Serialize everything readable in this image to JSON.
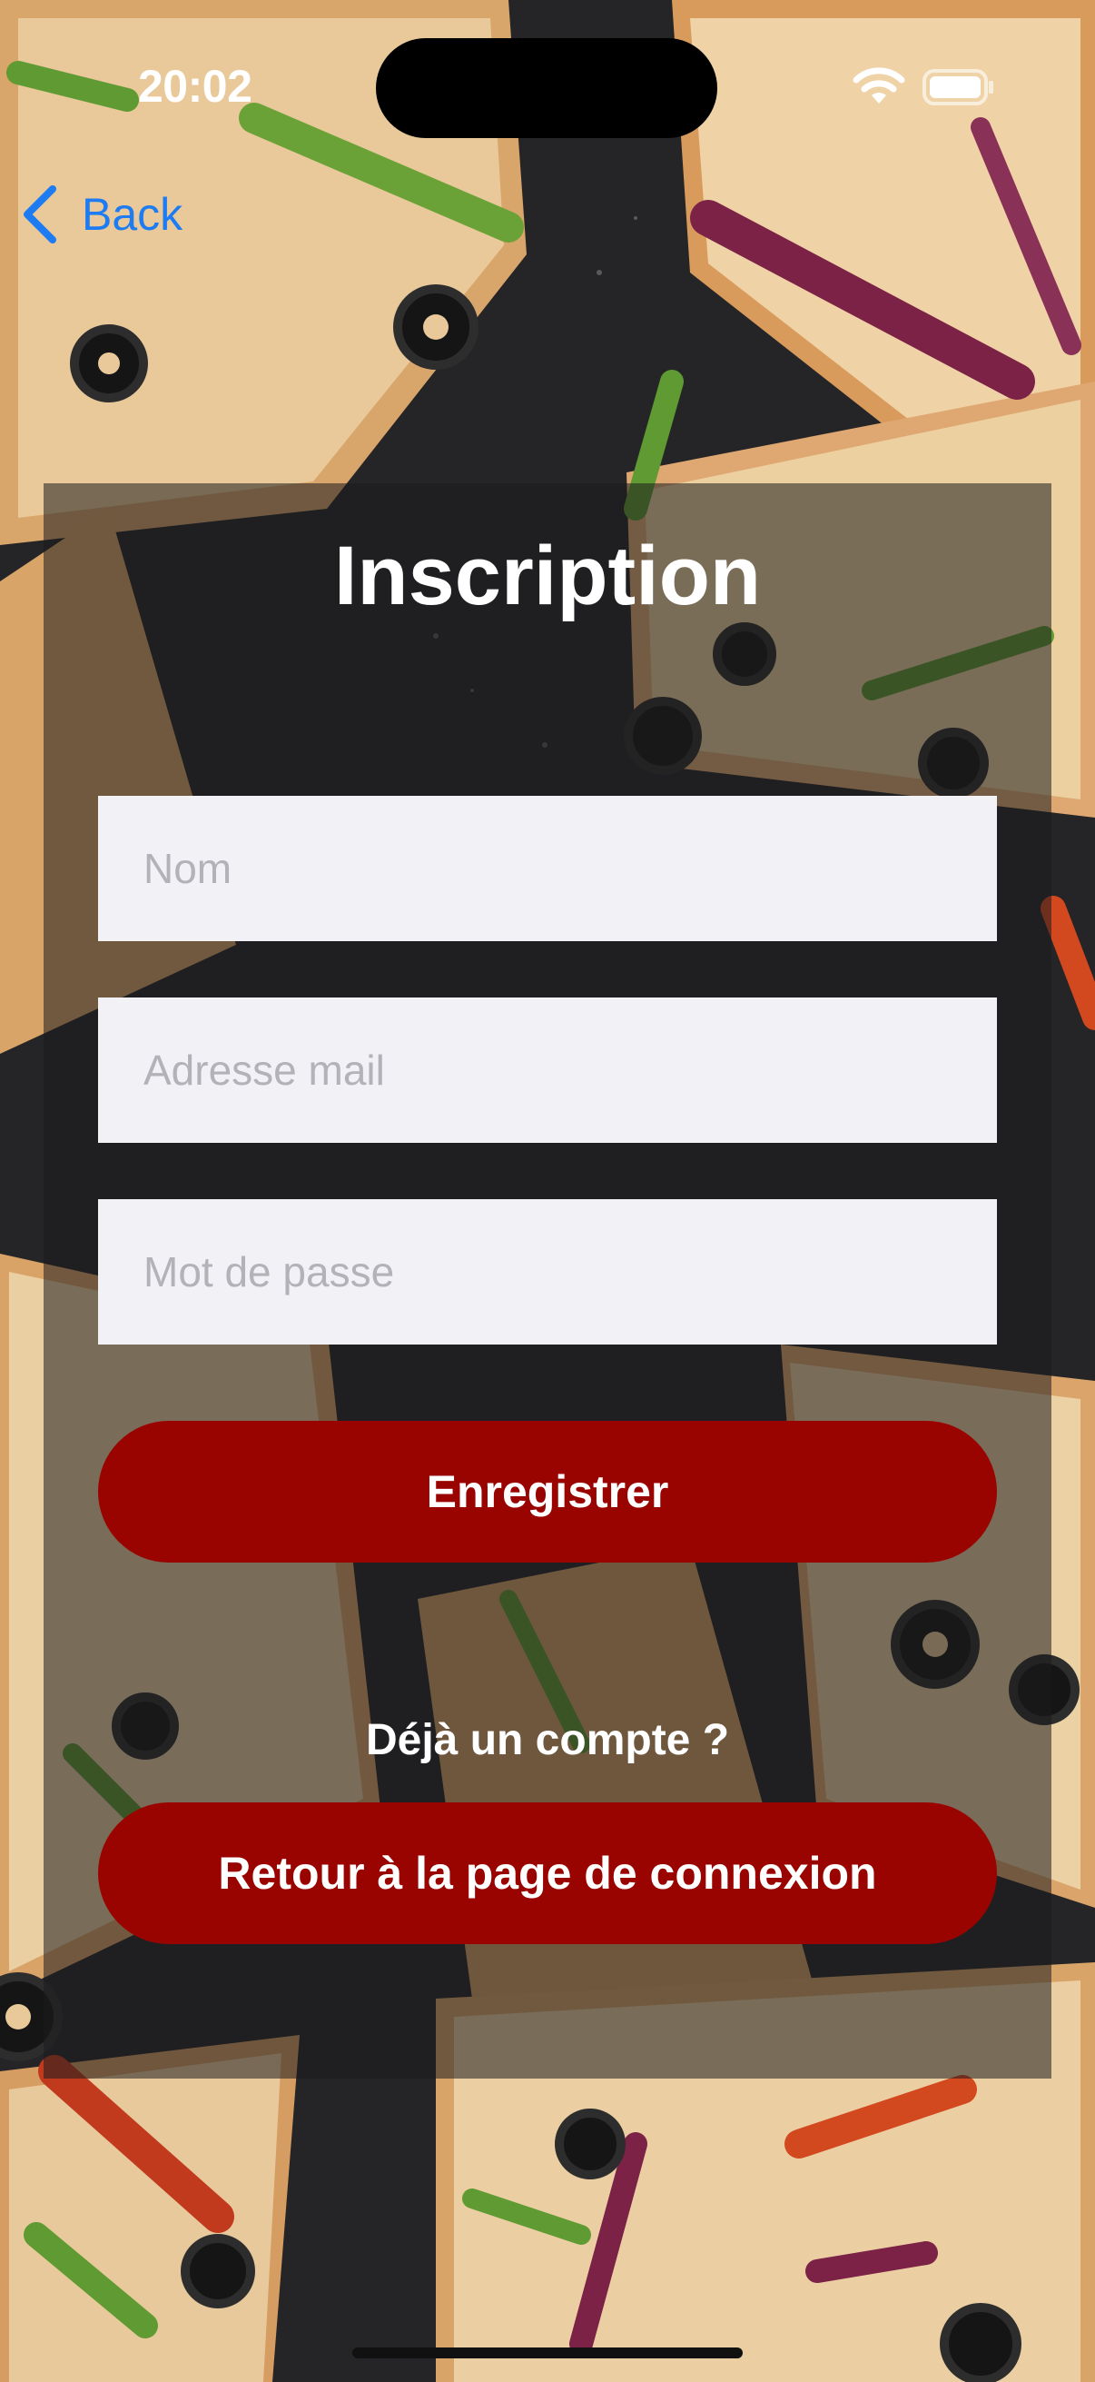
{
  "status_bar": {
    "time": "20:02"
  },
  "nav": {
    "back_label": "Back"
  },
  "form": {
    "title": "Inscription",
    "name_placeholder": "Nom",
    "email_placeholder": "Adresse mail",
    "password_placeholder": "Mot de passe",
    "register_label": "Enregistrer",
    "already_text": "Déjà un compte ?",
    "back_to_login_label": "Retour à la page de connexion"
  },
  "colors": {
    "accent": "#9a0400",
    "link": "#1e7cf2",
    "field_bg": "#f2f1f6"
  },
  "icons": [
    "wifi-icon",
    "battery-icon",
    "chevron-left-icon"
  ]
}
